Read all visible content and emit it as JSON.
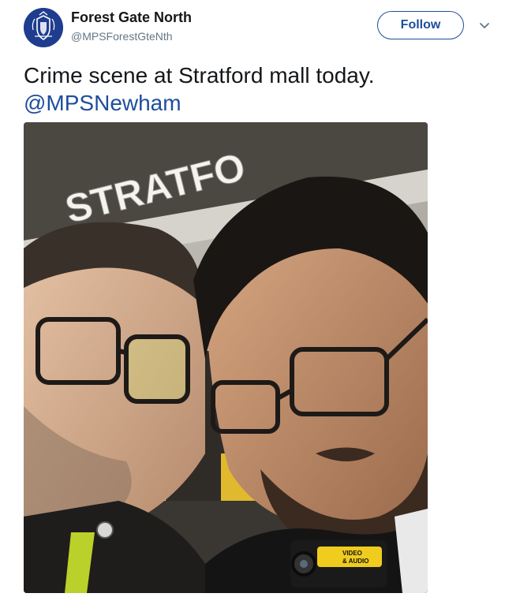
{
  "author": {
    "display_name": "Forest Gate North",
    "handle": "@MPSForestGteNth",
    "avatar_icon": "police-crest-icon",
    "avatar_color": "#1e3d8f"
  },
  "follow_button": {
    "label": "Follow",
    "color": "#1d4e9a"
  },
  "menu": {
    "icon": "chevron-down-icon"
  },
  "tweet": {
    "text": "Crime scene at Stratford mall today.",
    "mention": "@MPSNewham"
  },
  "photo": {
    "sign_text": "STRATFO",
    "camera_label_line1": "VIDEO",
    "camera_label_line2": "& AUDIO"
  }
}
